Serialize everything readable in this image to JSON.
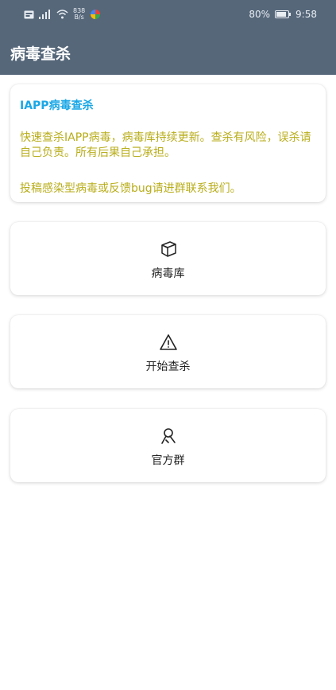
{
  "status_bar": {
    "speed_value": "838",
    "speed_unit": "B/s",
    "battery": "80%",
    "time": "9:58"
  },
  "app_bar": {
    "title": "病毒查杀"
  },
  "info_card": {
    "title": "IAPP病毒查杀",
    "description": "快速查杀IAPP病毒，病毒库持续更新。查杀有风险，误杀请自己负责。所有后果自己承担。",
    "contact": "投稿感染型病毒或反馈bug请进群联系我们。"
  },
  "actions": [
    {
      "label": "病毒库",
      "icon": "box-icon"
    },
    {
      "label": "开始查杀",
      "icon": "warning-icon"
    },
    {
      "label": "官方群",
      "icon": "group-icon"
    }
  ]
}
